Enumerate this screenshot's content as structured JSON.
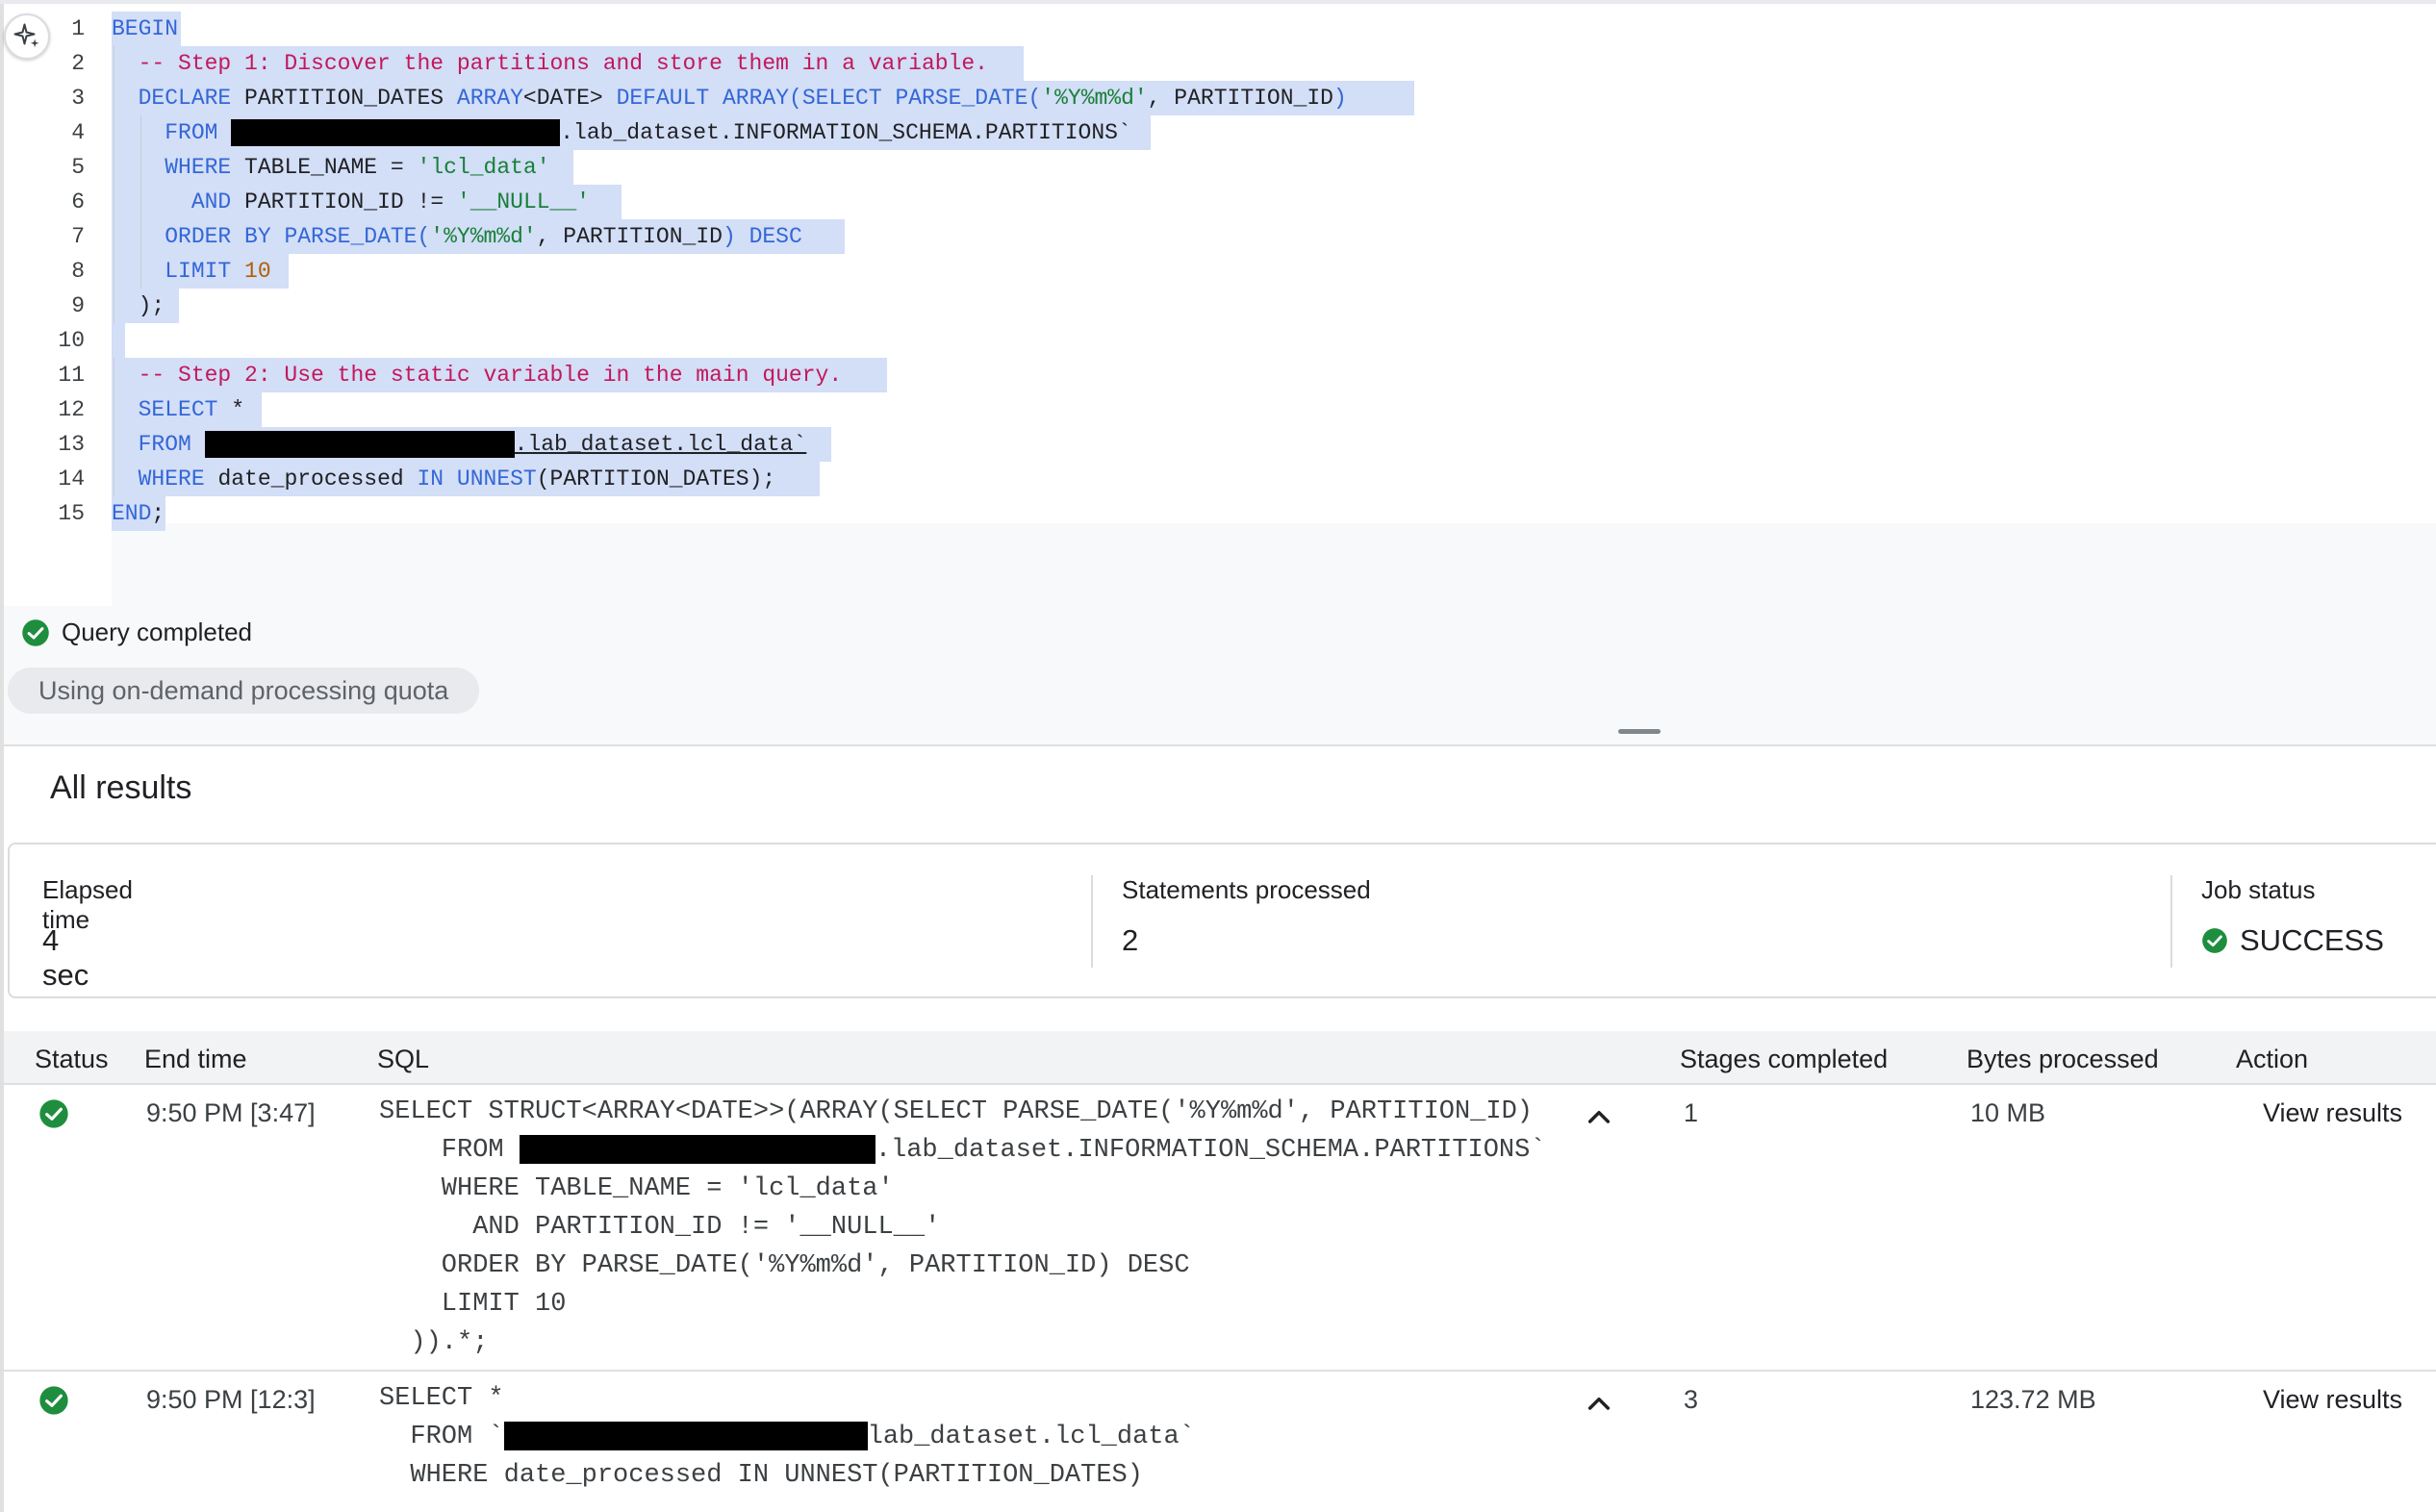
{
  "editor": {
    "line_numbers": [
      "1",
      "2",
      "3",
      "4",
      "5",
      "6",
      "7",
      "8",
      "9",
      "10",
      "11",
      "12",
      "13",
      "14",
      "15"
    ],
    "lines": {
      "l1": {
        "kw1": "BEGIN"
      },
      "l2": {
        "comment": "-- Step 1: Discover the partitions and store them in a variable."
      },
      "l3": {
        "kw1": "DECLARE",
        "id1": "PARTITION_DATES",
        "kw2": "ARRAY",
        "kw3": "<DATE>",
        "kw4": "DEFAULT",
        "kw5": "ARRAY",
        "kw6": "(SELECT",
        "kw7": "PARSE_DATE(",
        "str1": "'%Y%m%d'",
        "id2": ", PARTITION_ID",
        "kw8": ")"
      },
      "l4": {
        "kw1": "FROM",
        "id1": ".lab_dataset.INFORMATION_SCHEMA.PARTITIONS`"
      },
      "l5": {
        "kw1": "WHERE",
        "id1": "TABLE_NAME",
        "id2": "=",
        "str1": "'lcl_data'"
      },
      "l6": {
        "kw1": "AND",
        "id1": "PARTITION_ID",
        "id2": "!=",
        "str1": "'__NULL__'"
      },
      "l7": {
        "kw1": "ORDER BY",
        "kw2": "PARSE_DATE(",
        "str1": "'%Y%m%d'",
        "id1": ", PARTITION_ID",
        "kw3": ")",
        "kw4": "DESC"
      },
      "l8": {
        "kw1": "LIMIT",
        "num1": "10"
      },
      "l9": {
        "id1": ");"
      },
      "l11": {
        "comment": "-- Step 2: Use the static variable in the main query."
      },
      "l12": {
        "kw1": "SELECT",
        "id1": "*"
      },
      "l13": {
        "kw1": "FROM",
        "id1": ".lab_dataset.lcl_data`"
      },
      "l14": {
        "kw1": "WHERE",
        "id1": "date_processed",
        "kw2": "IN",
        "kw3": "UNNEST",
        "id2": "(PARTITION_DATES);"
      },
      "l15": {
        "kw1": "END",
        "id1": ";"
      }
    }
  },
  "status": {
    "query_completed": "Query completed",
    "quota_chip": "Using on-demand processing quota"
  },
  "results": {
    "title": "All results",
    "summary": {
      "elapsed_label": "Elapsed time",
      "elapsed_value": "4 sec",
      "statements_label": "Statements processed",
      "statements_value": "2",
      "job_status_label": "Job status",
      "job_status_value": "SUCCESS"
    },
    "columns": [
      "Status",
      "End time",
      "SQL",
      "Stages completed",
      "Bytes processed",
      "Action"
    ],
    "rows": [
      {
        "end_time": "9:50 PM [3:47]",
        "sql": {
          "l1": "SELECT STRUCT<ARRAY<DATE>>(ARRAY(SELECT PARSE_DATE('%Y%m%d', PARTITION_ID)",
          "l2a": "    FROM ",
          "l2b": ".lab_dataset.INFORMATION_SCHEMA.PARTITIONS`",
          "l3": "    WHERE TABLE_NAME = 'lcl_data'",
          "l4": "      AND PARTITION_ID != '__NULL__'",
          "l5": "    ORDER BY PARSE_DATE('%Y%m%d', PARTITION_ID) DESC",
          "l6": "    LIMIT 10",
          "l7": "  )).*;"
        },
        "stages": "1",
        "bytes": "10 MB",
        "action": "View results"
      },
      {
        "end_time": "9:50 PM [12:3]",
        "sql": {
          "l1": "SELECT *",
          "l2a": "  FROM `",
          "l2b": "lab_dataset.lcl_data`",
          "l3": "  WHERE date_processed IN UNNEST(PARTITION_DATES)"
        },
        "stages": "3",
        "bytes": "123.72 MB",
        "action": "View results"
      }
    ]
  },
  "colors": {
    "keyword": "#3367d6",
    "comment": "#c2185b",
    "string": "#188038",
    "number": "#b06000",
    "selection": "#d3def7",
    "success": "#1e8e3e"
  },
  "icons": {
    "sparkle": "sparkle-icon",
    "check": "check-circle-icon",
    "chevron": "chevron-up-icon"
  }
}
